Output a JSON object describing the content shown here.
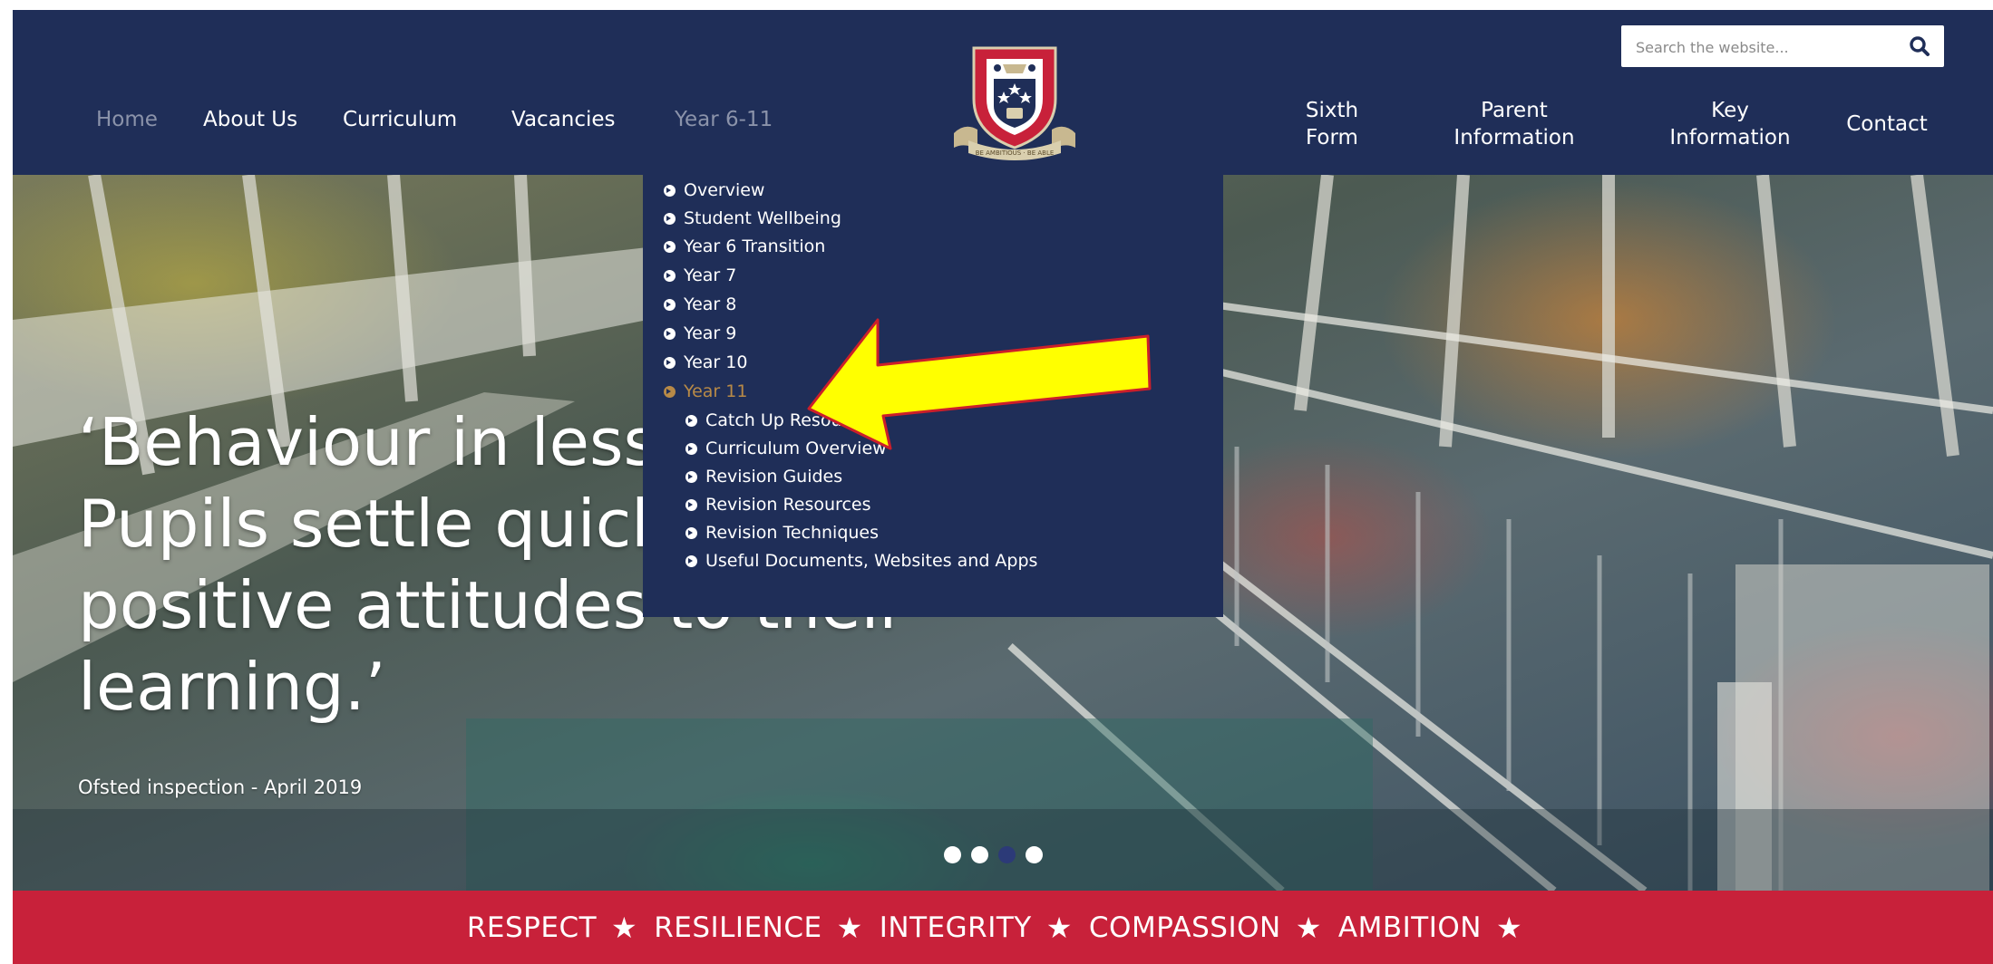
{
  "nav": {
    "left": [
      "Home",
      "About Us",
      "Curriculum",
      "Vacancies",
      "Year 6-11"
    ],
    "right": [
      {
        "line1": "Sixth",
        "line2": "Form"
      },
      {
        "line1": "Parent",
        "line2": "Information"
      },
      {
        "line1": "Key",
        "line2": "Information"
      },
      {
        "line1": "Contact",
        "line2": ""
      }
    ]
  },
  "search": {
    "placeholder": "Search the website..."
  },
  "crest": {
    "motto": "BE AMBITIOUS · BE ABLE"
  },
  "dropdown": {
    "items": [
      "Overview",
      "Student Wellbeing",
      "Year 6 Transition",
      "Year 7",
      "Year 8",
      "Year 9",
      "Year 10",
      "Year 11"
    ],
    "subitems": [
      "Catch Up Resources",
      "Curriculum Overview",
      "Revision Guides",
      "Revision Resources",
      "Revision Techniques",
      "Useful Documents, Websites and Apps"
    ]
  },
  "hero": {
    "quote": "‘Behaviour in lessons is good. Pupils settle quickly and have positive attitudes to their learning.’",
    "source": "Ofsted inspection - April 2019"
  },
  "values": [
    "RESPECT",
    "RESILIENCE",
    "INTEGRITY",
    "COMPASSION",
    "AMBITION"
  ],
  "colors": {
    "navy": "#1f2e58",
    "red": "#c8213a",
    "active_link": "#b88a47",
    "arrow": "#ffff00"
  }
}
